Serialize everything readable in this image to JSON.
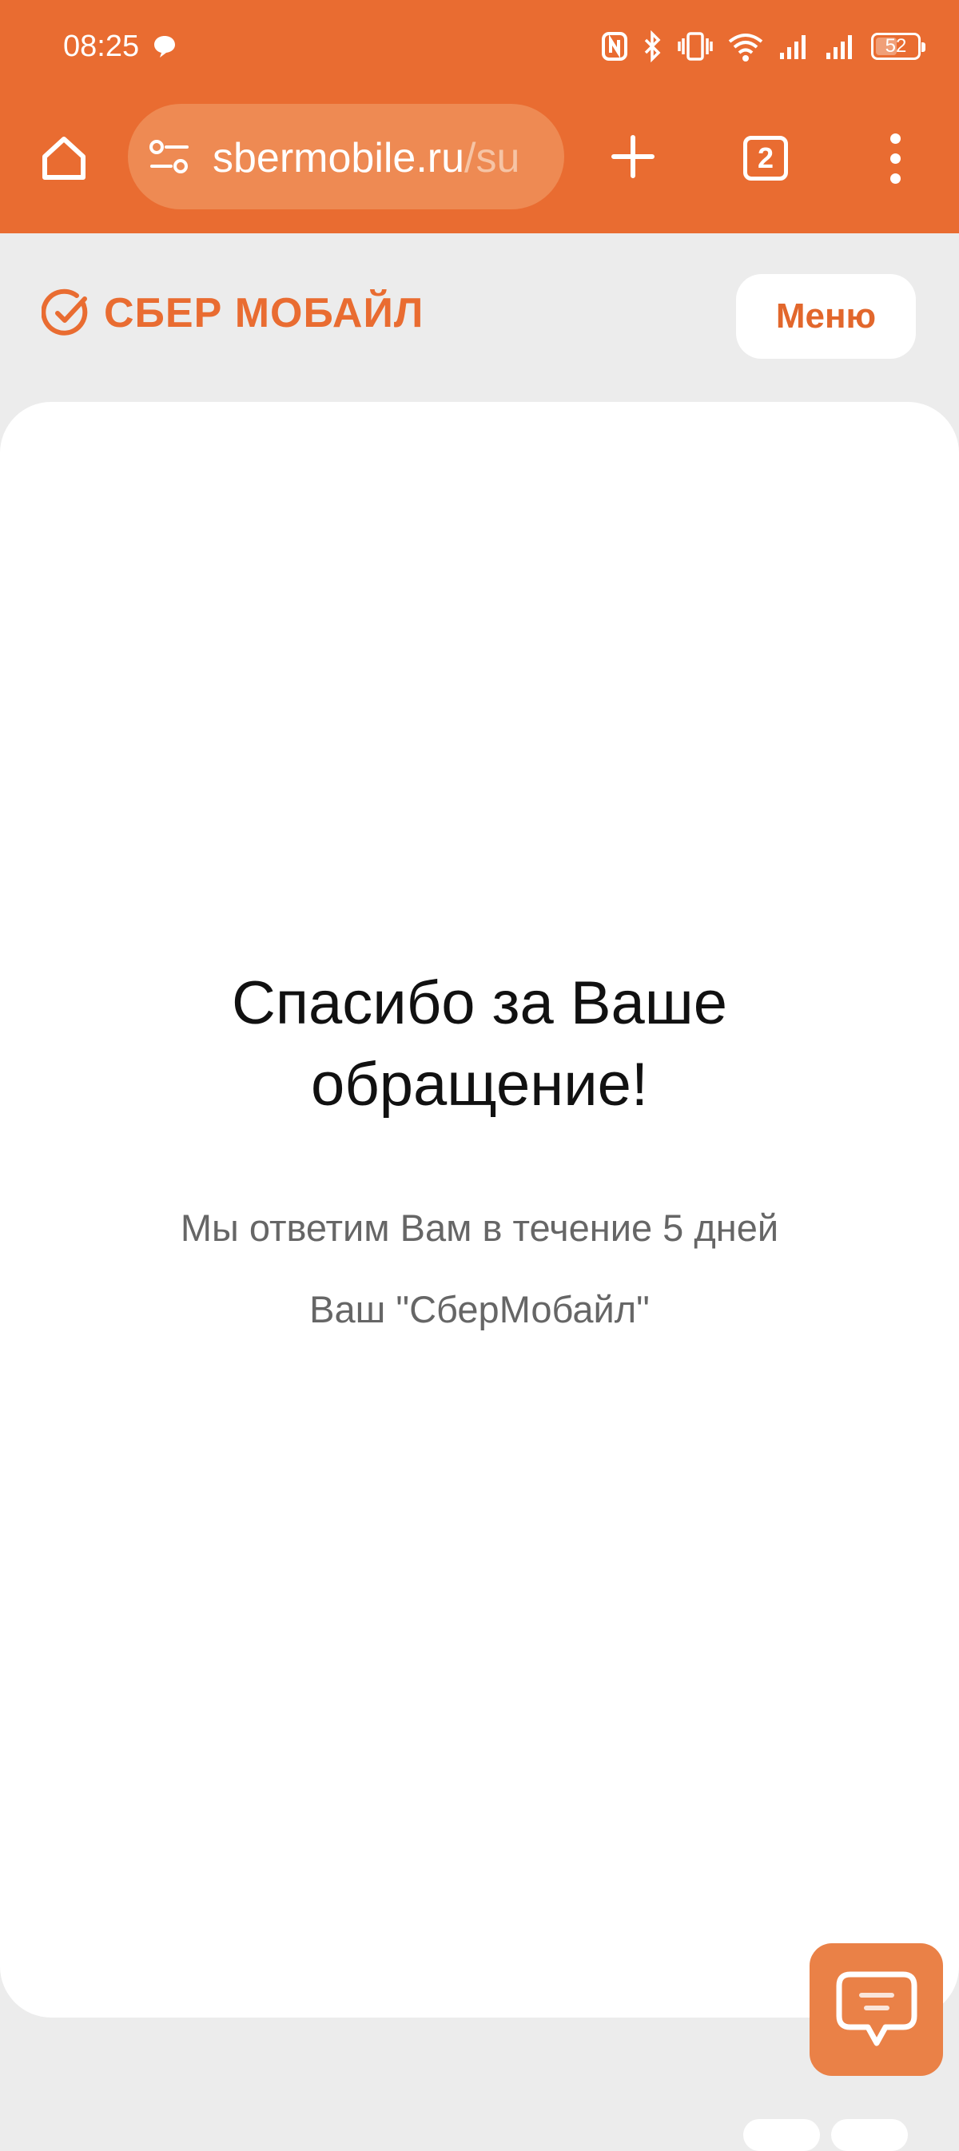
{
  "status_bar": {
    "time": "08:25",
    "battery": "52",
    "icons": [
      "message-icon",
      "nfc-icon",
      "bluetooth-icon",
      "vibrate-icon",
      "wifi-icon",
      "signal-icon",
      "signal-icon",
      "battery-icon"
    ]
  },
  "browser": {
    "url_main": "sbermobile.ru",
    "url_rest": "/su",
    "tab_count": "2",
    "colors": {
      "toolbar": "#e96c31",
      "urlbar": "#ee8a53"
    }
  },
  "site_header": {
    "logo_text": "СБЕР МОБАЙЛ",
    "menu_label": "Меню"
  },
  "content": {
    "heading_line1": "Спасибо за Ваше",
    "heading_line2": "обращение!",
    "message": "Мы ответим Вам в течение 5 дней",
    "signature": "Ваш \"СберМобайл\""
  },
  "chat": {
    "icon": "chat-icon",
    "color": "#ea8147"
  }
}
